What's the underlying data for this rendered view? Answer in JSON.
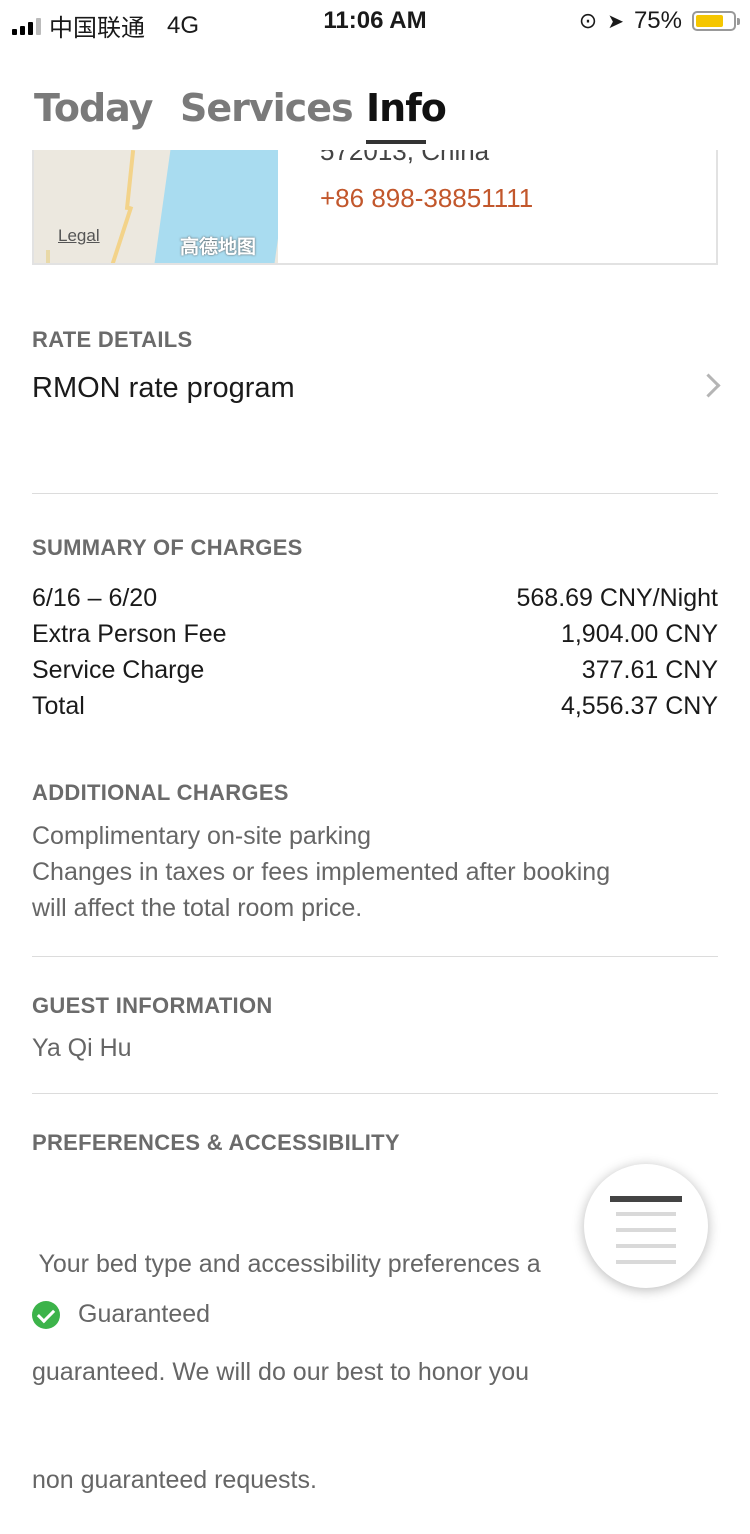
{
  "status_bar": {
    "carrier": "中国联通",
    "network": "4G",
    "time": "11:06 AM",
    "battery_percent": "75%",
    "battery_level": 0.75
  },
  "tabs": [
    {
      "label": "Today"
    },
    {
      "label": "Services"
    },
    {
      "label": "Info",
      "active": true
    }
  ],
  "hotel": {
    "address_partial": "572013, China",
    "phone": "+86 898-38851111",
    "map_legal": "Legal",
    "map_provider": "高德地图"
  },
  "rate_details": {
    "heading": "RATE DETAILS",
    "program": "RMON rate program"
  },
  "summary": {
    "heading": "SUMMARY OF CHARGES",
    "rows": [
      {
        "label": "6/16 – 6/20",
        "value": "568.69 CNY/Night"
      },
      {
        "label": "Extra Person Fee",
        "value": "1,904.00 CNY"
      },
      {
        "label": "Service Charge",
        "value": "377.61 CNY"
      },
      {
        "label": "Total",
        "value": "4,556.37 CNY"
      }
    ]
  },
  "additional": {
    "heading": "ADDITIONAL CHARGES",
    "line1": "Complimentary on-site parking",
    "line2": "Changes in taxes or fees implemented after booking",
    "line3": "will affect the total room price."
  },
  "guest": {
    "heading": "GUEST INFORMATION",
    "name": "Ya Qi Hu"
  },
  "preferences": {
    "heading": "PREFERENCES & ACCESSIBILITY",
    "line1": " Your bed type and accessibility preferences a",
    "line2": "guaranteed. We will do our best to honor you",
    "line3": "non guaranteed requests.",
    "guaranteed_label": "Guaranteed"
  },
  "colors": {
    "phone": "#c2572c",
    "check": "#3cb34a",
    "battery": "#f5c600"
  }
}
